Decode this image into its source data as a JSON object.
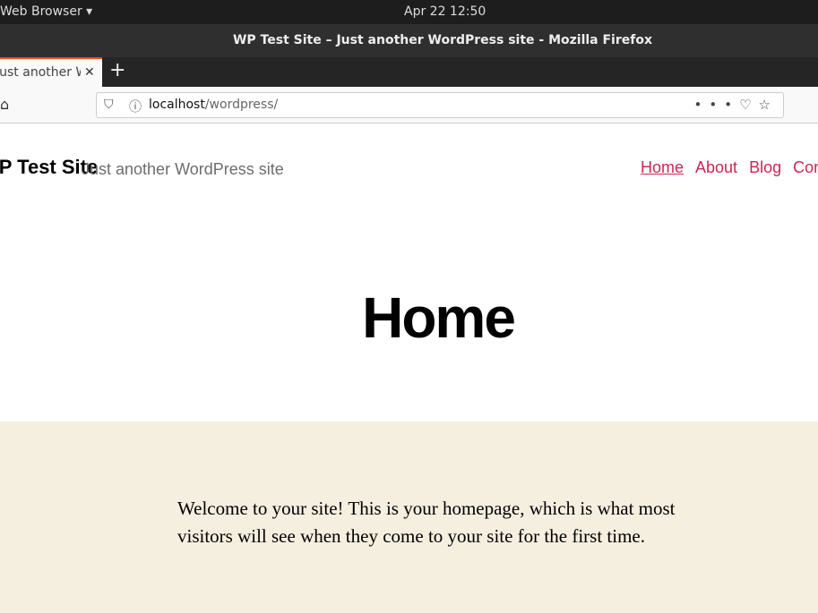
{
  "system": {
    "app_menu": "Web Browser ▾",
    "clock": "Apr 22  12:50"
  },
  "window": {
    "title": "WP Test Site – Just another WordPress site - Mozilla Firefox"
  },
  "tab": {
    "label": "Just another WordPress site",
    "close": "✕",
    "new_tab": "+"
  },
  "urlbar": {
    "host": "localhost",
    "path": "/wordpress/"
  },
  "site": {
    "title": "WP Test Site",
    "tagline": "Just another WordPress site",
    "nav": [
      {
        "label": "Home"
      },
      {
        "label": "About"
      },
      {
        "label": "Blog"
      },
      {
        "label": "Contact"
      }
    ]
  },
  "page": {
    "heading": "Home",
    "body": "Welcome to your site! This is your homepage, which is what most visitors will see when they come to your site for the first time."
  }
}
